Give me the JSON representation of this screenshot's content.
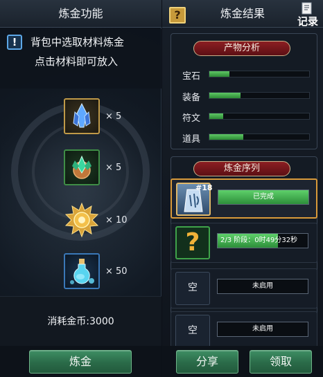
{
  "left_panel": {
    "title": "炼金功能",
    "hint_line1": "背包中选取材料炼金",
    "hint_line2": "点击材料即可放入",
    "materials": [
      {
        "icon": "blue-crystal-icon",
        "qty": "× 5"
      },
      {
        "icon": "green-gem-icon",
        "qty": "× 5"
      },
      {
        "icon": "gold-sun-medal-icon",
        "qty": "× 10"
      },
      {
        "icon": "blue-potion-icon",
        "qty": "× 50"
      }
    ],
    "cost_text": "消耗金币:3000",
    "alchemy_button": "炼金"
  },
  "right_panel": {
    "title": "炼金结果",
    "help_label": "?",
    "record_label": "记录",
    "analysis_title": "产物分析",
    "stats": [
      {
        "label": "宝石",
        "value": 0.2
      },
      {
        "label": "装备",
        "value": 0.31
      },
      {
        "label": "符文",
        "value": 0.14
      },
      {
        "label": "道具",
        "value": 0.34
      }
    ],
    "sequence_title": "炼金序列",
    "slots": [
      {
        "type": "done",
        "badge": "#18",
        "status": "已完成",
        "progress": 1.0
      },
      {
        "type": "pending",
        "icon_text": "?",
        "status": "2/3 阶段：0时49分32秒",
        "progress": 0.67
      },
      {
        "type": "empty",
        "icon_text": "空",
        "status": "未启用",
        "progress": 0
      },
      {
        "type": "empty",
        "icon_text": "空",
        "status": "未启用",
        "progress": 0
      }
    ],
    "share_button": "分享",
    "claim_button": "领取"
  },
  "colors": {
    "accent_green": "#2f7a55",
    "ribbon_red": "#7a161b",
    "progress_green": "#4cbf58",
    "active_border": "#d99a3a"
  }
}
